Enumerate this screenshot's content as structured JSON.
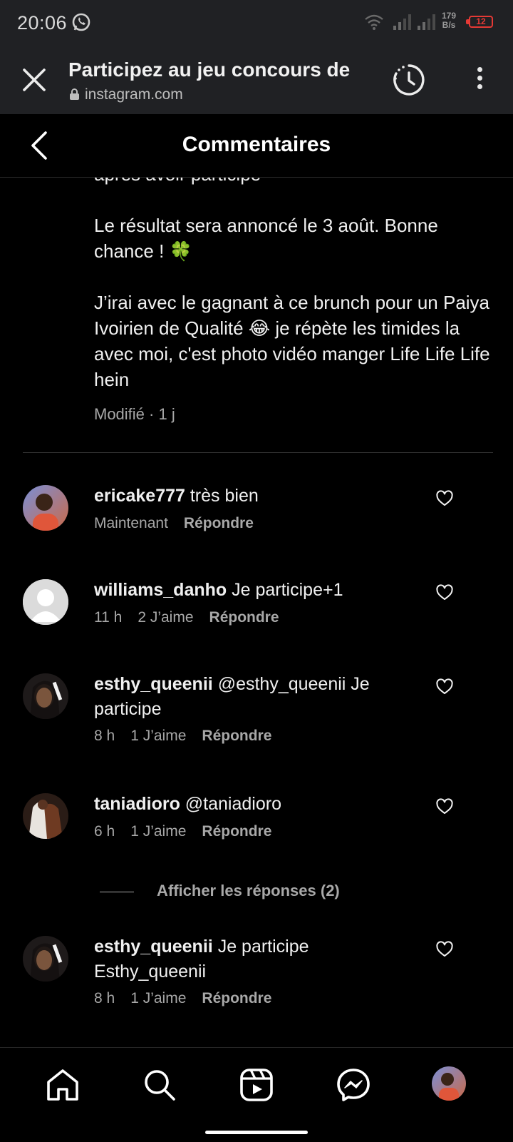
{
  "status_bar": {
    "time": "20:06",
    "speed_value": "179",
    "speed_unit": "B/s",
    "battery": "12"
  },
  "browser": {
    "title": "Participez au jeu concours de",
    "url": "instagram.com"
  },
  "comments_header": {
    "title": "Commentaires"
  },
  "caption": {
    "partial_line": "après avoir participé",
    "paragraph_1": "Le résultat sera annoncé le 3 août. Bonne chance ! 🍀",
    "paragraph_2": "J’irai avec le gagnant à ce brunch pour un Paiya Ivoirien de Qualité 😂 je répète les timides la avec moi, c'est photo vidéo manger Life Life Life hein",
    "meta": "Modifié · 1 j"
  },
  "comments": [
    {
      "username": "ericake777",
      "text": "très bien",
      "time": "Maintenant",
      "likes": "",
      "reply": "Répondre"
    },
    {
      "username": "williams_danho",
      "text": "Je participe+1",
      "time": "11 h",
      "likes": "2 J’aime",
      "reply": "Répondre"
    },
    {
      "username": "esthy_queenii",
      "text": "@esthy_queenii Je participe",
      "time": "8 h",
      "likes": "1 J’aime",
      "reply": "Répondre"
    },
    {
      "username": "taniadioro",
      "text": "@taniadioro",
      "time": "6 h",
      "likes": "1 J’aime",
      "reply": "Répondre"
    },
    {
      "username": "esthy_queenii",
      "text": "Je participe Esthy_queenii",
      "time": "8 h",
      "likes": "1 J’aime",
      "reply": "Répondre"
    }
  ],
  "view_replies": "Afficher les réponses (2)",
  "nav": [
    "home-icon",
    "search-icon",
    "reels-icon",
    "messenger-icon",
    "profile-avatar"
  ],
  "colors": {
    "background": "#000000",
    "chrome": "#202124",
    "muted_text": "#a8a8a8",
    "battery_low": "#e53935"
  }
}
